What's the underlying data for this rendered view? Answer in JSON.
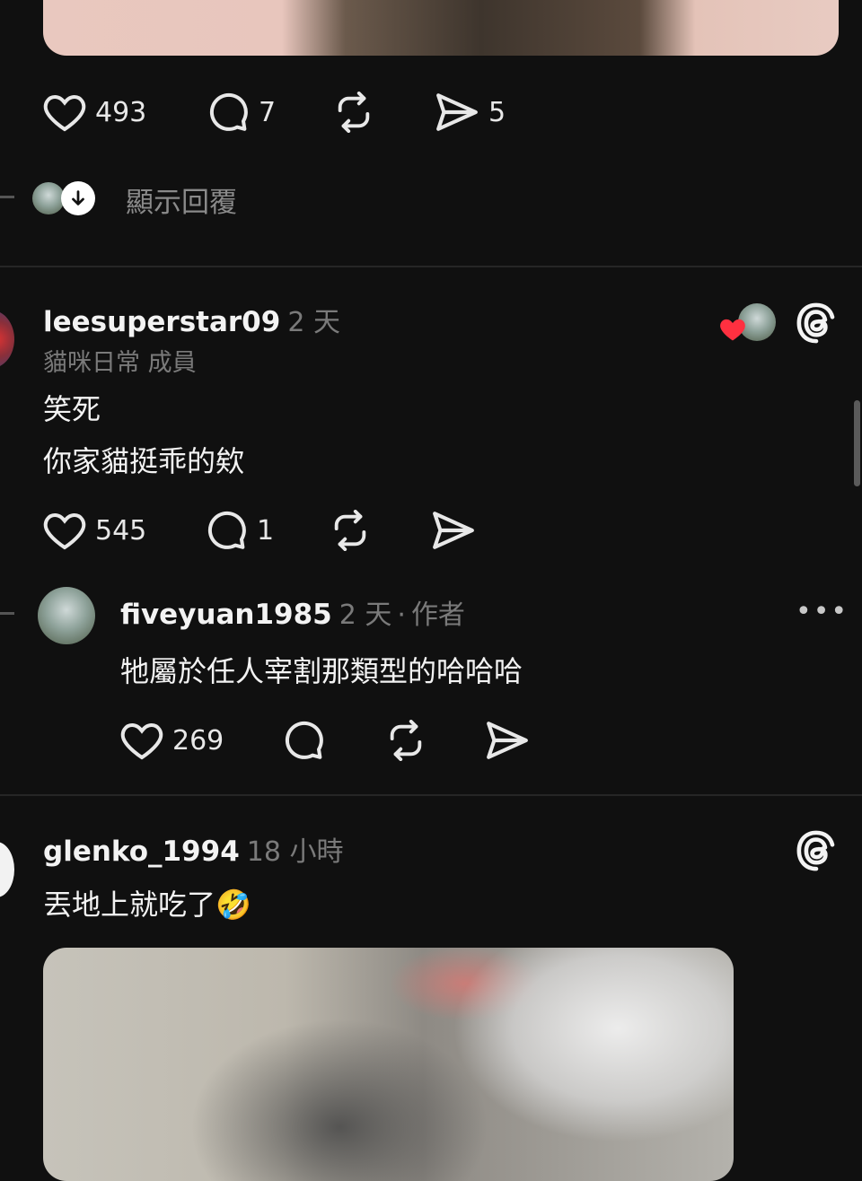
{
  "post": {
    "likes": "493",
    "comments": "7",
    "shares": "5"
  },
  "show_replies": {
    "label": "顯示回覆"
  },
  "reply1": {
    "username": "leesuperstar09",
    "time": "2 天",
    "community": "貓咪日常 成員",
    "lines": [
      "笑死",
      "你家貓挺乖的欸"
    ],
    "likes": "545",
    "comments": "1"
  },
  "reply2": {
    "username": "fiveyuan1985",
    "time": "2 天",
    "role": "作者",
    "text": "牠屬於任人宰割那類型的哈哈哈",
    "likes": "269"
  },
  "reply3": {
    "username": "glenko_1994",
    "time": "18 小時",
    "text": "丟地上就吃了🤣"
  },
  "colors": {
    "background": "#101010",
    "heart_red": "#ff3040",
    "muted_text": "#7a7a7a"
  }
}
